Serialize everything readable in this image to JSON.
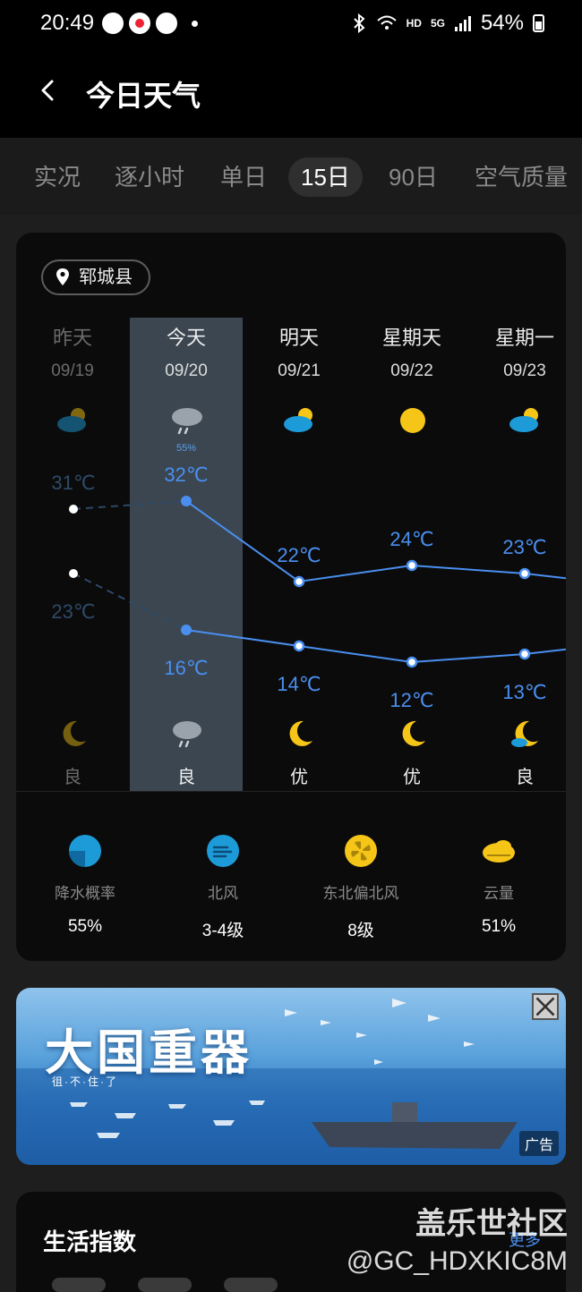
{
  "status_bar": {
    "time": "20:49",
    "network": "HD",
    "signal_label": "5G",
    "battery": "54%"
  },
  "header": {
    "title": "今日天气"
  },
  "tabs": [
    {
      "label": "实况",
      "active": false
    },
    {
      "label": "逐小时",
      "active": false
    },
    {
      "label": "单日",
      "active": false
    },
    {
      "label": "15日",
      "active": true
    },
    {
      "label": "90日",
      "active": false
    },
    {
      "label": "空气质量",
      "active": false
    }
  ],
  "location": "郓城县",
  "days": [
    {
      "name": "昨天",
      "date": "09/19",
      "day_icon": "partly-cloudy-icon",
      "night_icon": "moon-icon",
      "aqi": "良",
      "precip": ""
    },
    {
      "name": "今天",
      "date": "09/20",
      "day_icon": "rain-cloud-icon",
      "night_icon": "rain-cloud-icon",
      "aqi": "良",
      "precip": "55%"
    },
    {
      "name": "明天",
      "date": "09/21",
      "day_icon": "partly-cloudy-icon",
      "night_icon": "moon-icon",
      "aqi": "优",
      "precip": ""
    },
    {
      "name": "星期天",
      "date": "09/22",
      "day_icon": "sun-icon",
      "night_icon": "moon-icon",
      "aqi": "优",
      "precip": ""
    },
    {
      "name": "星期一",
      "date": "09/23",
      "day_icon": "partly-cloudy-icon",
      "night_icon": "cloudy-moon-icon",
      "aqi": "良",
      "precip": ""
    }
  ],
  "chart_data": {
    "type": "line",
    "categories": [
      "09/19",
      "09/20",
      "09/21",
      "09/22",
      "09/23"
    ],
    "series": [
      {
        "name": "",
        "values": [
          31,
          32,
          22,
          24,
          23
        ],
        "labels": [
          "31℃",
          "32℃",
          "22℃",
          "24℃",
          "23℃"
        ]
      },
      {
        "name": "",
        "values": [
          23,
          16,
          14,
          12,
          13
        ],
        "labels": [
          "23℃",
          "16℃",
          "14℃",
          "12℃",
          "13℃"
        ]
      }
    ],
    "colors": {
      "line": "#4a8ff0",
      "past": "#2e4a68"
    },
    "grid": false
  },
  "details": [
    {
      "icon": "rain-probability-icon",
      "label": "降水概率",
      "value": "55%"
    },
    {
      "icon": "wind-icon",
      "label": "北风",
      "value": "3-4级"
    },
    {
      "icon": "fan-icon",
      "label": "东北偏北风",
      "value": "8级"
    },
    {
      "icon": "cloud-icon",
      "label": "云量",
      "value": "51%"
    }
  ],
  "ad": {
    "title": "大国重器",
    "subtitle": "徂·不·住·了",
    "tag": "广告"
  },
  "life": {
    "title": "生活指数",
    "more": "更多"
  },
  "watermark": {
    "line1": "盖乐世社区",
    "line2": "@GC_HDXKIC8M"
  },
  "colors": {
    "accent": "#4a8ff0",
    "sun": "#f5c518",
    "cloud_blue": "#1d9bd8",
    "highlight": "#3b4650"
  }
}
